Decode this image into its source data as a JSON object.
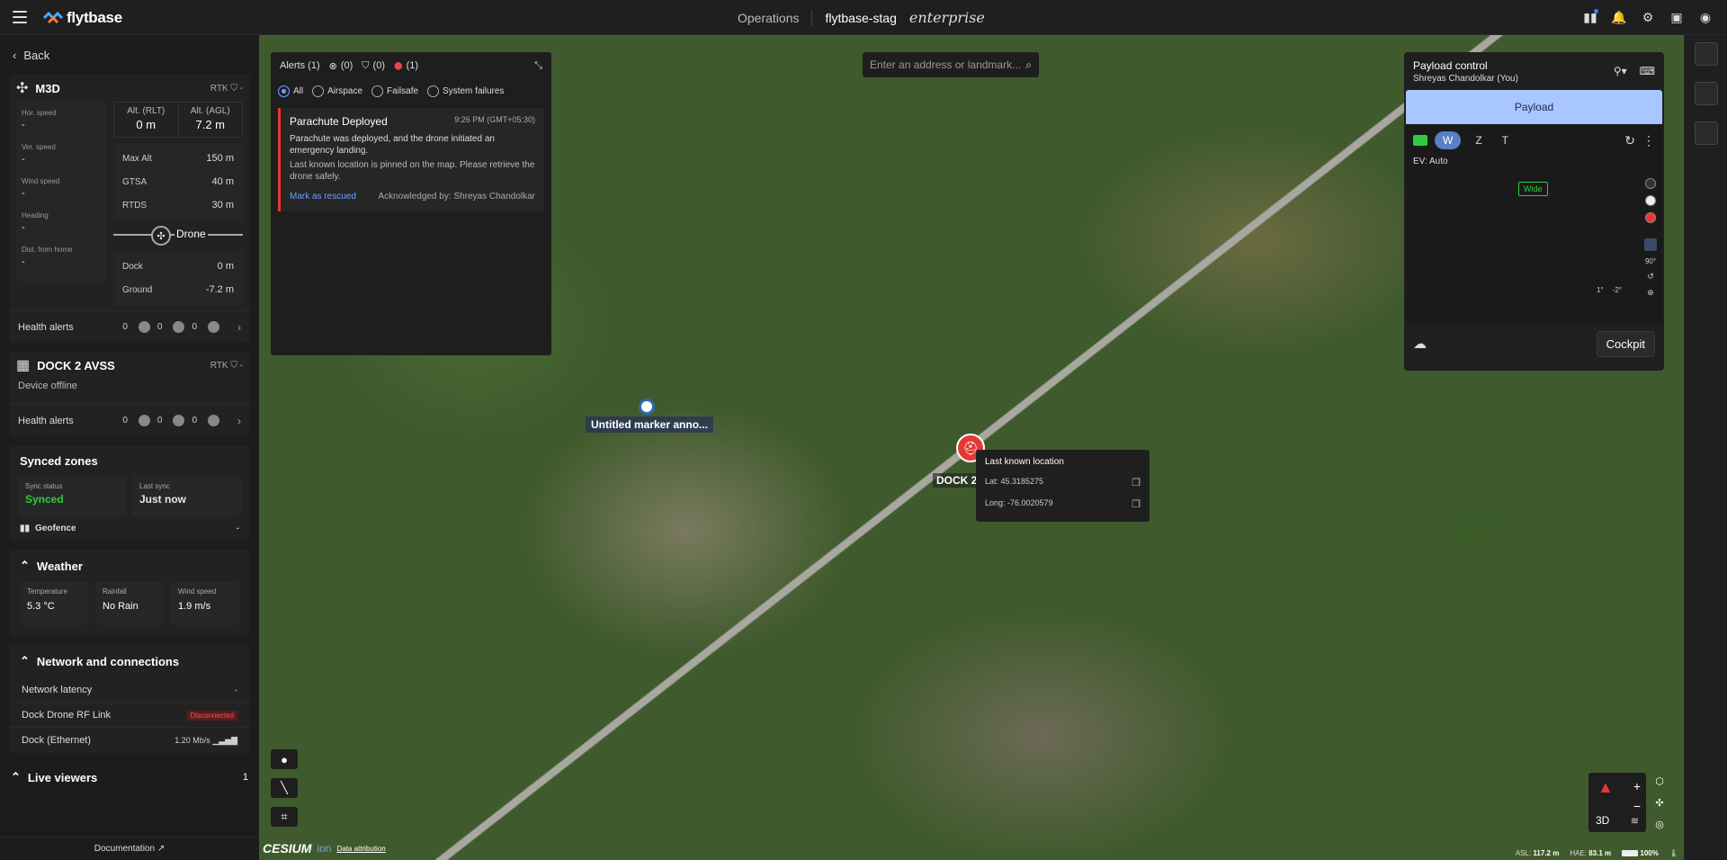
{
  "topbar": {
    "brand": "flytbase",
    "operations": "Operations",
    "org": "flytbase-stag",
    "edition": "enterprise",
    "icons": [
      "dashboard-icon",
      "bell-icon",
      "settings-icon",
      "gift-icon",
      "user-icon"
    ]
  },
  "sidebar": {
    "back": "Back",
    "drone": {
      "name": "M3D",
      "rtk": "RTK",
      "telemetry": [
        {
          "label": "Hor. speed",
          "value": "-"
        },
        {
          "label": "Ver. speed",
          "value": "-"
        },
        {
          "label": "Wind speed",
          "value": "-"
        },
        {
          "label": "Heading",
          "value": "-"
        },
        {
          "label": "Dist. from home",
          "value": "-"
        }
      ],
      "alt_rlt_label": "Alt. (RLT)",
      "alt_rlt": "0 m",
      "alt_agl_label": "Alt. (AGL)",
      "alt_agl": "7.2 m",
      "limits": [
        {
          "label": "Max Alt",
          "value": "150 m"
        },
        {
          "label": "GTSA",
          "value": "40 m"
        },
        {
          "label": "RTDS",
          "value": "30 m"
        }
      ],
      "slider_label": "Drone",
      "refs": [
        {
          "label": "Dock",
          "value": "0 m"
        },
        {
          "label": "Ground",
          "value": "-7.2 m"
        }
      ],
      "health_label": "Health alerts",
      "health_counts": [
        "0",
        "0",
        "0"
      ]
    },
    "dock": {
      "name": "DOCK 2 AVSS",
      "rtk": "RTK",
      "status": "Device offline",
      "health_label": "Health alerts",
      "health_counts": [
        "0",
        "0",
        "0"
      ]
    },
    "synced_zones": {
      "title": "Synced zones",
      "sync_status_label": "Sync status",
      "sync_status": "Synced",
      "last_sync_label": "Last sync",
      "last_sync": "Just now",
      "geofence": "Geofence",
      "geofence_value": "-"
    },
    "weather": {
      "title": "Weather",
      "temperature_label": "Temperature",
      "temperature": "5.3 °C",
      "rainfall_label": "Rainfall",
      "rainfall": "No Rain",
      "wind_label": "Wind speed",
      "wind": "1.9 m/s"
    },
    "network": {
      "title": "Network and connections",
      "latency_label": "Network latency",
      "latency": "-",
      "rf_label": "Dock Drone RF Link",
      "rf_status": "Disconnected",
      "eth_label": "Dock (Ethernet)",
      "eth_value": "1.20 Mb/s"
    },
    "live_viewers": {
      "title": "Live viewers",
      "count": "1"
    },
    "documentation": "Documentation"
  },
  "alerts": {
    "title": "Alerts (1)",
    "count_a": "(0)",
    "count_b": "(0)",
    "count_c": "(1)",
    "filters": [
      "All",
      "Airspace",
      "Failsafe",
      "System failures"
    ],
    "item": {
      "title": "Parachute Deployed",
      "time": "9:26 PM (GMT+05:30)",
      "desc": "Parachute was deployed, and the drone initiated an emergency landing.",
      "desc2": "Last known location is pinned on the map. Please retrieve the drone safely.",
      "action": "Mark as rescued",
      "ack": "Acknowledged by: Shreyas Chandolkar"
    }
  },
  "search": {
    "placeholder": "Enter an address or landmark..."
  },
  "map": {
    "marker_label": "Untitled marker anno...",
    "dock_label": "DOCK 2",
    "popup": {
      "title": "Last known location",
      "lat": "Lat: 45.3185275",
      "long": "Long: -76.0020579"
    }
  },
  "payload": {
    "title": "Payload control",
    "user": "Shreyas Chandolkar (You)",
    "tab": "Payload",
    "zoom": [
      "W",
      "Z",
      "T"
    ],
    "ev": "EV: Auto",
    "lens": "Wide",
    "gimbal_a": "1°",
    "gimbal_b": "-2°",
    "cockpit": "Cockpit"
  },
  "map_controls": {
    "mode": "3D"
  },
  "status": {
    "asl_label": "ASL:",
    "asl": "117.2 m",
    "hae_label": "HAE:",
    "hae": "83.1 m",
    "battery": "100%"
  },
  "cesium": {
    "brand": "CESIUM",
    "ion": "ion",
    "attribution": "Data attribution"
  },
  "colors": {
    "accent": "#6aa0ff",
    "alert": "#e53935",
    "payload_tab": "#a8c6ff",
    "ok": "#2ecc40"
  }
}
